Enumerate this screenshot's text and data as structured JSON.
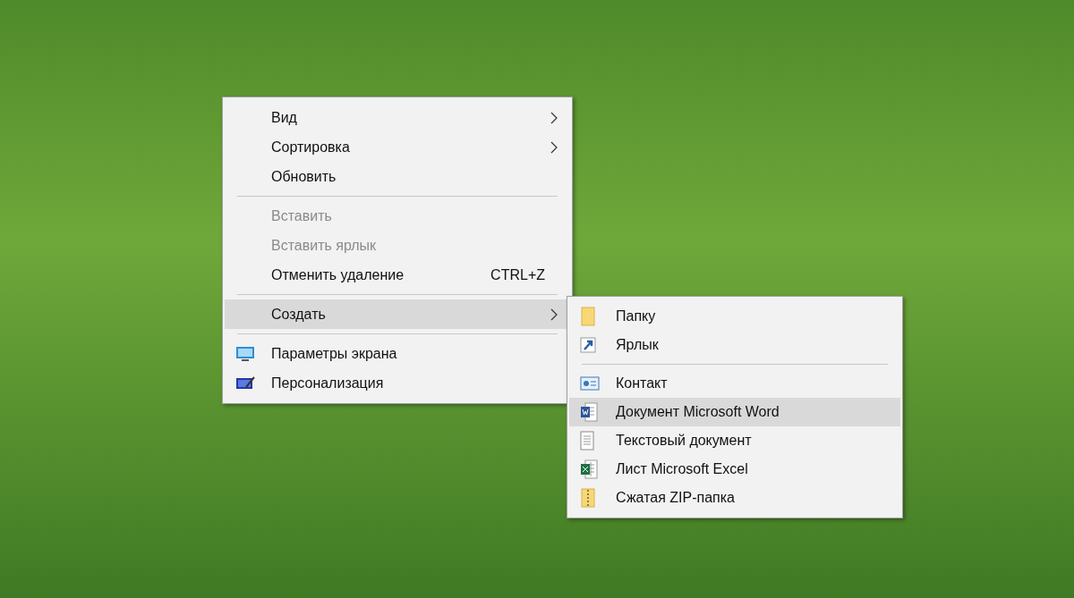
{
  "context_menu": {
    "items": [
      {
        "kind": "plain",
        "label": "Вид",
        "disabled": false,
        "selected": false,
        "submenu": true
      },
      {
        "kind": "plain",
        "label": "Сортировка",
        "disabled": false,
        "selected": false,
        "submenu": true
      },
      {
        "kind": "plain",
        "label": "Обновить",
        "disabled": false,
        "selected": false,
        "submenu": false
      },
      {
        "kind": "separator"
      },
      {
        "kind": "plain",
        "label": "Вставить",
        "disabled": true,
        "selected": false,
        "submenu": false
      },
      {
        "kind": "plain",
        "label": "Вставить ярлык",
        "disabled": true,
        "selected": false,
        "submenu": false
      },
      {
        "kind": "plain",
        "label": "Отменить удаление",
        "shortcut": "CTRL+Z",
        "disabled": false,
        "selected": false,
        "submenu": false
      },
      {
        "kind": "separator"
      },
      {
        "kind": "plain",
        "label": "Создать",
        "disabled": false,
        "selected": true,
        "submenu": true
      },
      {
        "kind": "separator"
      },
      {
        "kind": "monitor",
        "label": "Параметры экрана",
        "disabled": false,
        "selected": false,
        "submenu": false
      },
      {
        "kind": "personalize",
        "label": "Персонализация",
        "disabled": false,
        "selected": false,
        "submenu": false
      }
    ]
  },
  "submenu": {
    "items": [
      {
        "kind": "folder",
        "label": "Папку",
        "selected": false
      },
      {
        "kind": "shortcut",
        "label": "Ярлык",
        "selected": false
      },
      {
        "kind": "separator"
      },
      {
        "kind": "contact",
        "label": "Контакт",
        "selected": false
      },
      {
        "kind": "word",
        "label": "Документ Microsoft Word",
        "selected": true
      },
      {
        "kind": "text",
        "label": "Текстовый документ",
        "selected": false
      },
      {
        "kind": "excel",
        "label": "Лист Microsoft Excel",
        "selected": false
      },
      {
        "kind": "zip",
        "label": "Сжатая ZIP-папка",
        "selected": false
      }
    ]
  }
}
